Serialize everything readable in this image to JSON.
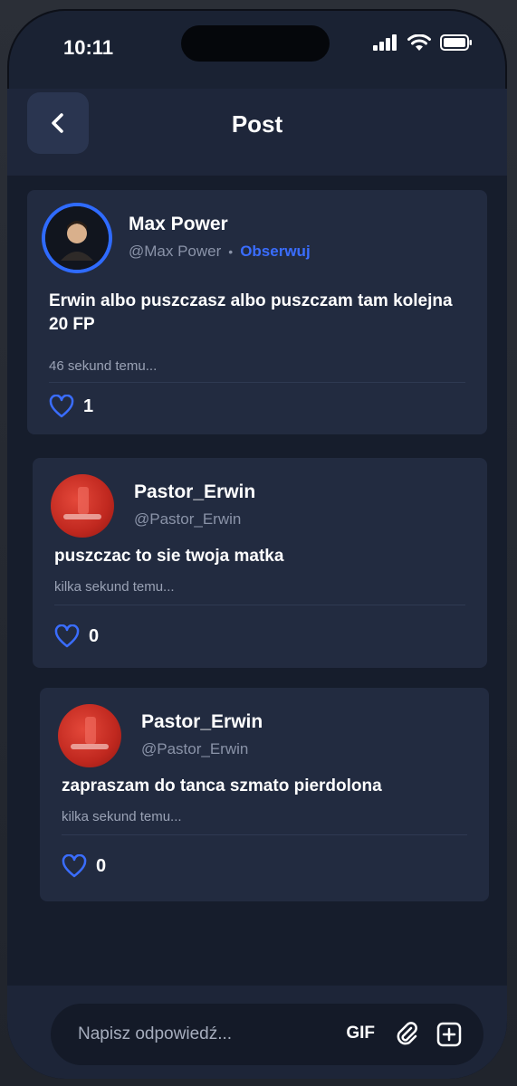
{
  "status_bar": {
    "time": "10:11",
    "icons": [
      "signal-icon",
      "wifi-icon",
      "battery-icon"
    ]
  },
  "header": {
    "back_icon": "chevron-left-icon",
    "title": "Post"
  },
  "posts": [
    {
      "name": "Max Power",
      "handle": "@Max Power",
      "follow_label": "Obserwuj",
      "text": "Erwin albo puszczasz albo puszczam tam kolejna 20 FP",
      "time_ago": "46 sekund temu...",
      "likes": "1"
    },
    {
      "name": "Pastor_Erwin",
      "handle": "@Pastor_Erwin",
      "text": "puszczac to sie twoja matka",
      "time_ago": "kilka sekund temu...",
      "likes": "0"
    },
    {
      "name": "Pastor_Erwin",
      "handle": "@Pastor_Erwin",
      "text": "zapraszam do tanca szmato pierdolona",
      "time_ago": "kilka sekund temu...",
      "likes": "0"
    }
  ],
  "reply": {
    "placeholder": "Napisz odpowiedź...",
    "gif_label": "GIF",
    "attach_icon": "paperclip-icon",
    "image_icon": "image-add-icon"
  },
  "colors": {
    "accent": "#3a6dff",
    "card_bg": "#222b40",
    "screen_bg": "#161d2c"
  }
}
